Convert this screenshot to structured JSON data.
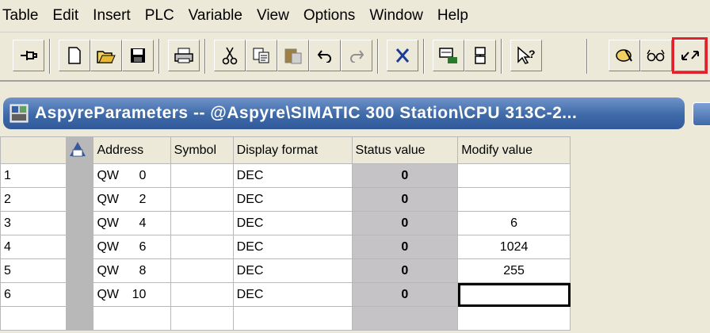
{
  "menubar": {
    "items": [
      "Table",
      "Edit",
      "Insert",
      "PLC",
      "Variable",
      "View",
      "Options",
      "Window",
      "Help"
    ]
  },
  "toolbar": {
    "icons": [
      "pin-icon",
      "new-icon",
      "open-icon",
      "save-icon",
      "print-icon",
      "cut-icon",
      "copy-icon",
      "paste-icon",
      "undo-icon",
      "redo-icon",
      "delete-icon",
      "monitor-icon",
      "network-icon",
      "help-icon",
      "force-icon",
      "monitor-glasses-icon",
      "modify-arrows-icon"
    ]
  },
  "window": {
    "title": "AspyreParameters -- @Aspyre\\SIMATIC 300 Station\\CPU 313C-2..."
  },
  "table": {
    "headers": [
      "Address",
      "Symbol",
      "Display format",
      "Status value",
      "Modify value"
    ],
    "rows": [
      {
        "num": "1",
        "addr": "QW",
        "idx": "0",
        "symbol": "",
        "format": "DEC",
        "status": "0",
        "modify": ""
      },
      {
        "num": "2",
        "addr": "QW",
        "idx": "2",
        "symbol": "",
        "format": "DEC",
        "status": "0",
        "modify": ""
      },
      {
        "num": "3",
        "addr": "QW",
        "idx": "4",
        "symbol": "",
        "format": "DEC",
        "status": "0",
        "modify": "6"
      },
      {
        "num": "4",
        "addr": "QW",
        "idx": "6",
        "symbol": "",
        "format": "DEC",
        "status": "0",
        "modify": "1024"
      },
      {
        "num": "5",
        "addr": "QW",
        "idx": "8",
        "symbol": "",
        "format": "DEC",
        "status": "0",
        "modify": "255"
      },
      {
        "num": "6",
        "addr": "QW",
        "idx": "10",
        "symbol": "",
        "format": "DEC",
        "status": "0",
        "modify": ""
      }
    ]
  },
  "colors": {
    "titlebar": "#3e6aa8",
    "highlight": "#e0202a",
    "status_bg": "#c6c3c6"
  }
}
